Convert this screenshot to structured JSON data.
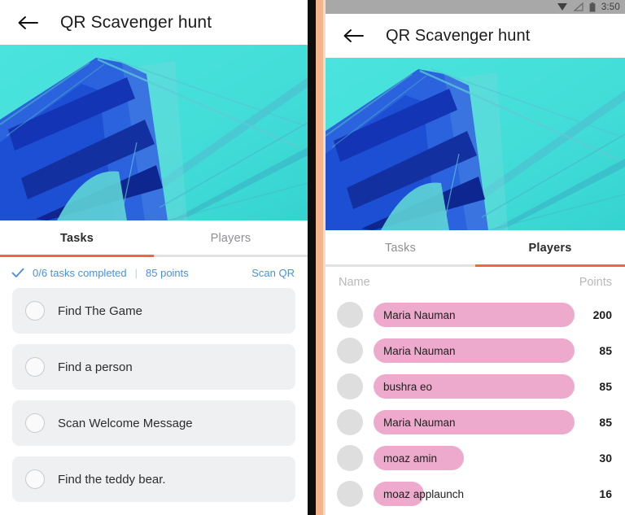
{
  "left_panel": {
    "appbar": {
      "back_icon": "back-arrow-icon",
      "title": "QR Scavenger hunt"
    },
    "hero": {
      "alt": "duotone-bridge-photo",
      "sky_color": "#46e0da",
      "structure_color": "#1b4fd8"
    },
    "tabs": [
      {
        "label": "Tasks",
        "active": true
      },
      {
        "label": "Players",
        "active": false
      }
    ],
    "status": {
      "check_icon": "check-icon",
      "tasks_completed": "0/6 tasks completed",
      "separator": "|",
      "points": "85 points",
      "scan_link": "Scan QR",
      "accent_color": "#4a90e2"
    },
    "tasks": [
      {
        "label": "Find The Game",
        "checked": false
      },
      {
        "label": "Find a person",
        "checked": false
      },
      {
        "label": "Scan Welcome Message",
        "checked": false
      },
      {
        "label": "Find the teddy bear.",
        "checked": false
      }
    ]
  },
  "right_panel": {
    "statusbar": {
      "icons": [
        "wifi-triangle-icon",
        "signal-off-icon",
        "battery-icon"
      ],
      "time": "3:50"
    },
    "appbar": {
      "back_icon": "back-arrow-icon",
      "title": "QR Scavenger hunt"
    },
    "hero": {
      "alt": "duotone-bridge-photo"
    },
    "tabs": [
      {
        "label": "Tasks",
        "active": false
      },
      {
        "label": "Players",
        "active": true
      }
    ],
    "list_header": {
      "name": "Name",
      "points": "Points"
    },
    "players": [
      {
        "name": "Maria Nauman",
        "points": "200",
        "bar_pct": 100
      },
      {
        "name": "Maria Nauman",
        "points": "85",
        "bar_pct": 100
      },
      {
        "name": "bushra eo",
        "points": "85",
        "bar_pct": 100
      },
      {
        "name": "Maria Nauman",
        "points": "85",
        "bar_pct": 100
      },
      {
        "name": "moaz amin",
        "points": "30",
        "bar_pct": 45
      },
      {
        "name": "moaz applaunch",
        "points": "16",
        "bar_pct": 25
      }
    ],
    "bar_color": "#eeaacc"
  },
  "theme": {
    "accent_orange": "#f4663a",
    "accent_blue": "#4a90e2",
    "divider_black": "#0d0d0d",
    "divider_peach": "#f6b48a"
  }
}
